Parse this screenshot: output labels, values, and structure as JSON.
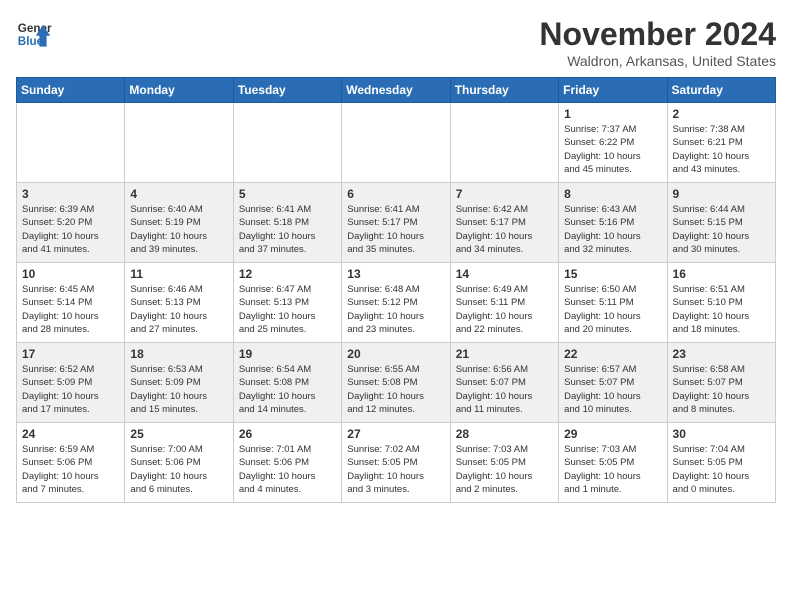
{
  "header": {
    "logo_line1": "General",
    "logo_line2": "Blue",
    "month": "November 2024",
    "location": "Waldron, Arkansas, United States"
  },
  "weekdays": [
    "Sunday",
    "Monday",
    "Tuesday",
    "Wednesday",
    "Thursday",
    "Friday",
    "Saturday"
  ],
  "weeks": [
    [
      {
        "day": "",
        "info": ""
      },
      {
        "day": "",
        "info": ""
      },
      {
        "day": "",
        "info": ""
      },
      {
        "day": "",
        "info": ""
      },
      {
        "day": "",
        "info": ""
      },
      {
        "day": "1",
        "info": "Sunrise: 7:37 AM\nSunset: 6:22 PM\nDaylight: 10 hours\nand 45 minutes."
      },
      {
        "day": "2",
        "info": "Sunrise: 7:38 AM\nSunset: 6:21 PM\nDaylight: 10 hours\nand 43 minutes."
      }
    ],
    [
      {
        "day": "3",
        "info": "Sunrise: 6:39 AM\nSunset: 5:20 PM\nDaylight: 10 hours\nand 41 minutes."
      },
      {
        "day": "4",
        "info": "Sunrise: 6:40 AM\nSunset: 5:19 PM\nDaylight: 10 hours\nand 39 minutes."
      },
      {
        "day": "5",
        "info": "Sunrise: 6:41 AM\nSunset: 5:18 PM\nDaylight: 10 hours\nand 37 minutes."
      },
      {
        "day": "6",
        "info": "Sunrise: 6:41 AM\nSunset: 5:17 PM\nDaylight: 10 hours\nand 35 minutes."
      },
      {
        "day": "7",
        "info": "Sunrise: 6:42 AM\nSunset: 5:17 PM\nDaylight: 10 hours\nand 34 minutes."
      },
      {
        "day": "8",
        "info": "Sunrise: 6:43 AM\nSunset: 5:16 PM\nDaylight: 10 hours\nand 32 minutes."
      },
      {
        "day": "9",
        "info": "Sunrise: 6:44 AM\nSunset: 5:15 PM\nDaylight: 10 hours\nand 30 minutes."
      }
    ],
    [
      {
        "day": "10",
        "info": "Sunrise: 6:45 AM\nSunset: 5:14 PM\nDaylight: 10 hours\nand 28 minutes."
      },
      {
        "day": "11",
        "info": "Sunrise: 6:46 AM\nSunset: 5:13 PM\nDaylight: 10 hours\nand 27 minutes."
      },
      {
        "day": "12",
        "info": "Sunrise: 6:47 AM\nSunset: 5:13 PM\nDaylight: 10 hours\nand 25 minutes."
      },
      {
        "day": "13",
        "info": "Sunrise: 6:48 AM\nSunset: 5:12 PM\nDaylight: 10 hours\nand 23 minutes."
      },
      {
        "day": "14",
        "info": "Sunrise: 6:49 AM\nSunset: 5:11 PM\nDaylight: 10 hours\nand 22 minutes."
      },
      {
        "day": "15",
        "info": "Sunrise: 6:50 AM\nSunset: 5:11 PM\nDaylight: 10 hours\nand 20 minutes."
      },
      {
        "day": "16",
        "info": "Sunrise: 6:51 AM\nSunset: 5:10 PM\nDaylight: 10 hours\nand 18 minutes."
      }
    ],
    [
      {
        "day": "17",
        "info": "Sunrise: 6:52 AM\nSunset: 5:09 PM\nDaylight: 10 hours\nand 17 minutes."
      },
      {
        "day": "18",
        "info": "Sunrise: 6:53 AM\nSunset: 5:09 PM\nDaylight: 10 hours\nand 15 minutes."
      },
      {
        "day": "19",
        "info": "Sunrise: 6:54 AM\nSunset: 5:08 PM\nDaylight: 10 hours\nand 14 minutes."
      },
      {
        "day": "20",
        "info": "Sunrise: 6:55 AM\nSunset: 5:08 PM\nDaylight: 10 hours\nand 12 minutes."
      },
      {
        "day": "21",
        "info": "Sunrise: 6:56 AM\nSunset: 5:07 PM\nDaylight: 10 hours\nand 11 minutes."
      },
      {
        "day": "22",
        "info": "Sunrise: 6:57 AM\nSunset: 5:07 PM\nDaylight: 10 hours\nand 10 minutes."
      },
      {
        "day": "23",
        "info": "Sunrise: 6:58 AM\nSunset: 5:07 PM\nDaylight: 10 hours\nand 8 minutes."
      }
    ],
    [
      {
        "day": "24",
        "info": "Sunrise: 6:59 AM\nSunset: 5:06 PM\nDaylight: 10 hours\nand 7 minutes."
      },
      {
        "day": "25",
        "info": "Sunrise: 7:00 AM\nSunset: 5:06 PM\nDaylight: 10 hours\nand 6 minutes."
      },
      {
        "day": "26",
        "info": "Sunrise: 7:01 AM\nSunset: 5:06 PM\nDaylight: 10 hours\nand 4 minutes."
      },
      {
        "day": "27",
        "info": "Sunrise: 7:02 AM\nSunset: 5:05 PM\nDaylight: 10 hours\nand 3 minutes."
      },
      {
        "day": "28",
        "info": "Sunrise: 7:03 AM\nSunset: 5:05 PM\nDaylight: 10 hours\nand 2 minutes."
      },
      {
        "day": "29",
        "info": "Sunrise: 7:03 AM\nSunset: 5:05 PM\nDaylight: 10 hours\nand 1 minute."
      },
      {
        "day": "30",
        "info": "Sunrise: 7:04 AM\nSunset: 5:05 PM\nDaylight: 10 hours\nand 0 minutes."
      }
    ]
  ]
}
